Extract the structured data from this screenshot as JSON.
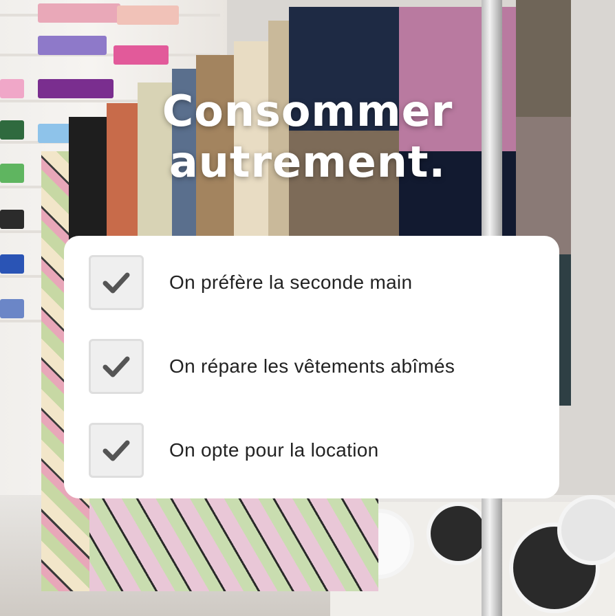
{
  "title": {
    "line1": "Consommer",
    "line2": "autrement."
  },
  "checklist": {
    "items": [
      {
        "label": "On préfère la seconde main",
        "checked": true
      },
      {
        "label": "On répare les vêtements abîmés",
        "checked": true
      },
      {
        "label": "On opte pour la location",
        "checked": true
      }
    ]
  },
  "colors": {
    "card_background": "#ffffff",
    "checkbox_background": "#efefef",
    "checkmark": "#555555",
    "title_text": "#ffffff",
    "label_text": "#222222"
  }
}
